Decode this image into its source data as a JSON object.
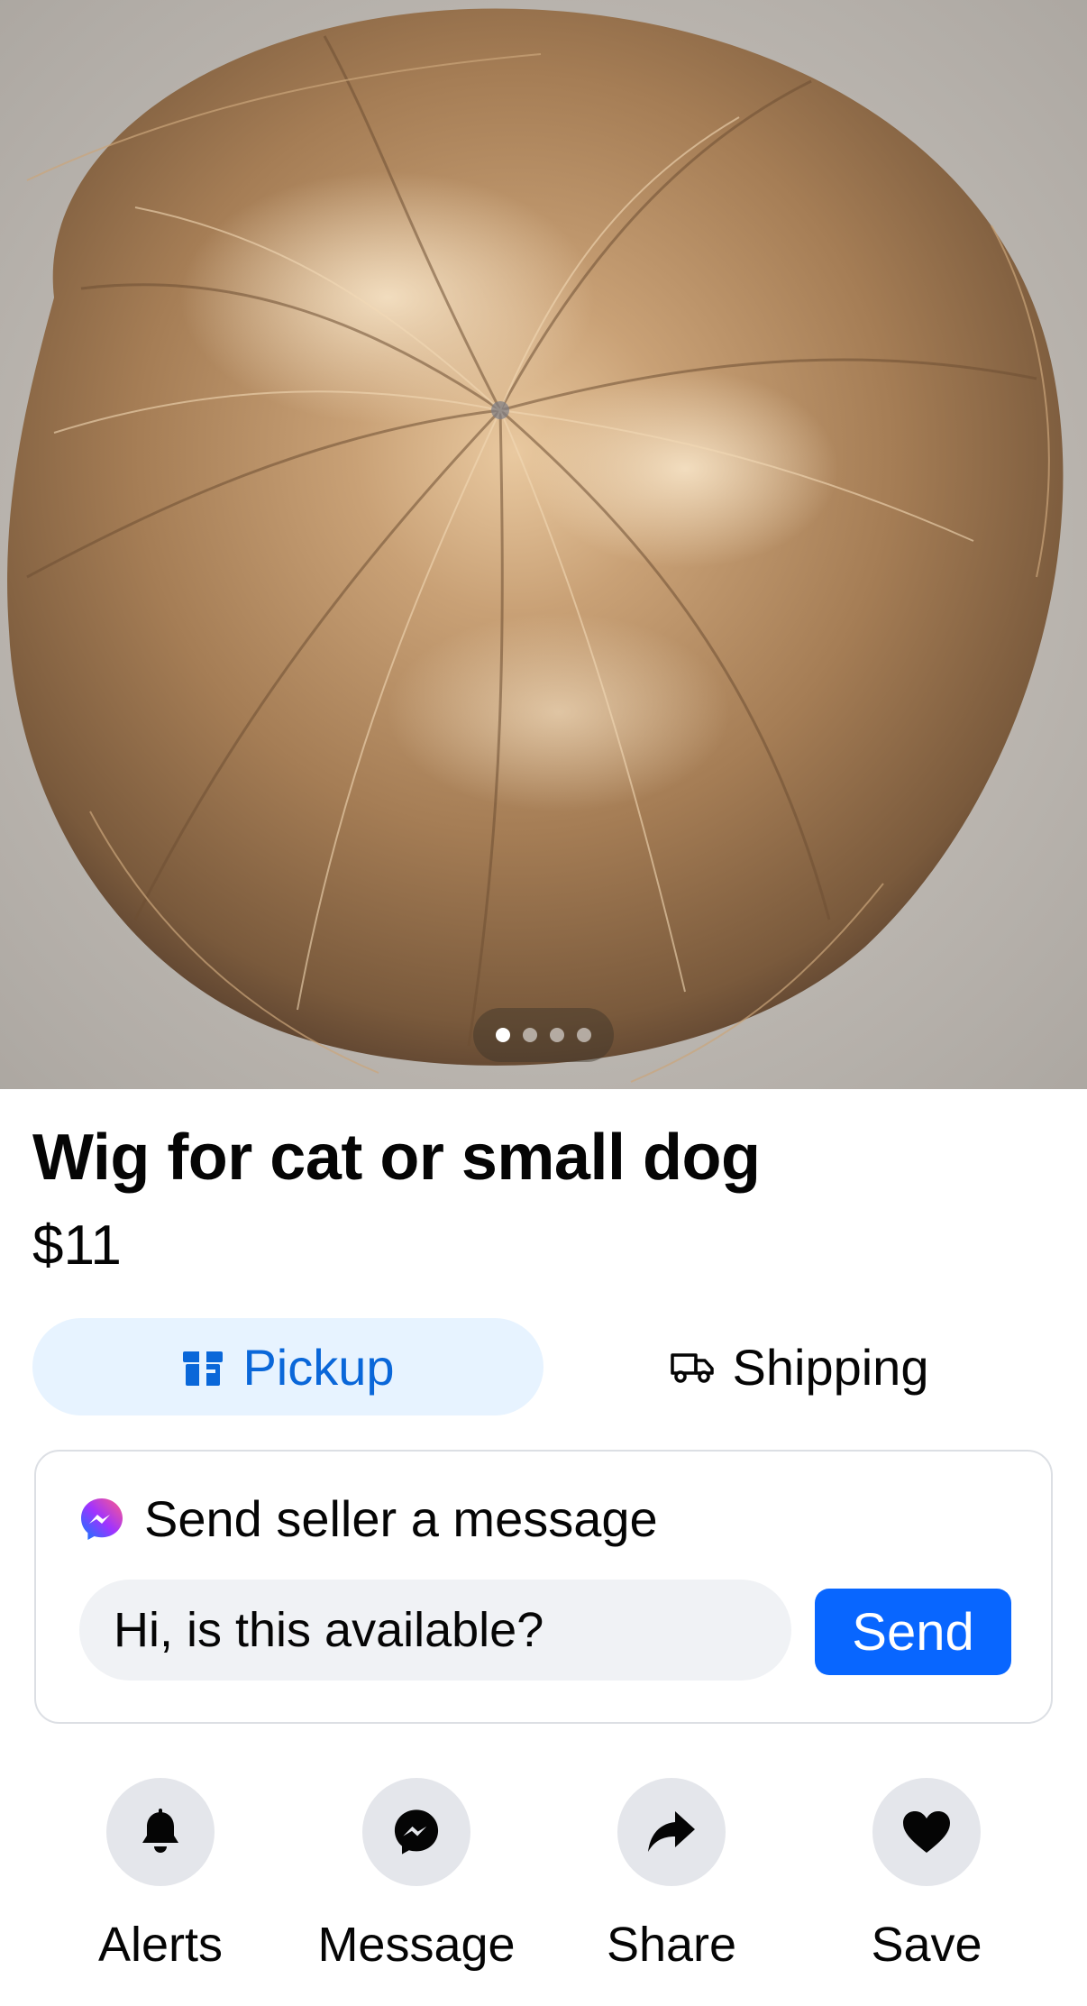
{
  "listing": {
    "title": "Wig for cat or small dog",
    "price": "$11",
    "photo_count": 4,
    "active_photo_index": 0
  },
  "delivery": {
    "pickup_label": "Pickup",
    "shipping_label": "Shipping",
    "selected": "pickup"
  },
  "message": {
    "header": "Send seller a message",
    "input_value": "Hi, is this available?",
    "send_label": "Send"
  },
  "actions": [
    {
      "label": "Alerts",
      "icon": "bell-icon"
    },
    {
      "label": "Message",
      "icon": "messenger-icon"
    },
    {
      "label": "Share",
      "icon": "share-icon"
    },
    {
      "label": "Save",
      "icon": "heart-icon"
    }
  ],
  "colors": {
    "accent": "#0866ff",
    "pickup_bg": "#e7f3ff",
    "pickup_text": "#0a67d9",
    "action_circle_bg": "#e4e6eb",
    "input_bg": "#f0f2f5"
  }
}
